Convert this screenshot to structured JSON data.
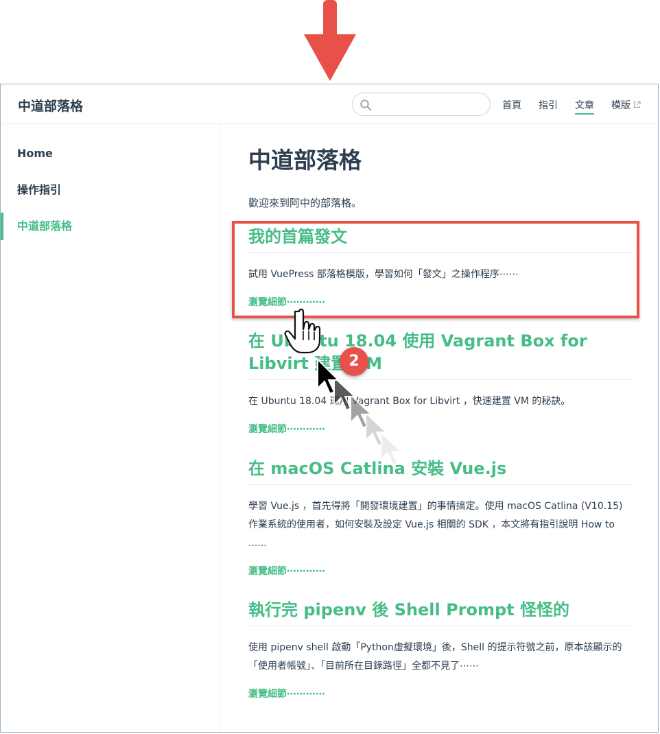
{
  "navbar": {
    "site_name": "中道部落格",
    "search_placeholder": "",
    "links": [
      {
        "label": "首頁"
      },
      {
        "label": "指引"
      },
      {
        "label": "文章"
      },
      {
        "label": "模版"
      }
    ]
  },
  "sidebar": {
    "items": [
      {
        "label": "Home"
      },
      {
        "label": "操作指引"
      },
      {
        "label": "中道部落格"
      }
    ]
  },
  "main": {
    "title": "中道部落格",
    "intro": "歡迎來到阿中的部落格。",
    "posts": [
      {
        "title": "我的首篇發文",
        "excerpt": "試用 VuePress 部落格模版，學習如何「發文」之操作程序⋯⋯",
        "more": "瀏覽細節⋯⋯⋯⋯"
      },
      {
        "title": "在 Ubuntu 18.04 使用 Vagrant Box for Libvirt 建置 VM",
        "excerpt": "在 Ubuntu 18.04 運用 Vagrant Box for Libvirt ，快速建置 VM 的秘訣。",
        "more": "瀏覽細節⋯⋯⋯⋯"
      },
      {
        "title": "在 macOS Catlina 安裝 Vue.js",
        "excerpt": "學習 Vue.js ，首先得將「開發環境建置」的事情搞定。使用 macOS Catlina (V10.15) 作業系統的使用者，如何安裝及設定 Vue.js 相關的 SDK ，本文將有指引說明 How to ......",
        "more": "瀏覽細節⋯⋯⋯⋯"
      },
      {
        "title": "執行完 pipenv 後 Shell Prompt 怪怪的",
        "excerpt": "使用 pipenv shell 啟動「Python虛擬環境」後，Shell 的提示符號之前，原本該顯示的「使用者帳號」、「目前所在目錄路徑」全都不見了⋯⋯",
        "more": "瀏覽細節⋯⋯⋯⋯"
      }
    ]
  },
  "annotation": {
    "step_number": "2"
  },
  "colors": {
    "accent": "#46bd87",
    "text": "#2c3e50",
    "annotation_red": "#e8514a"
  }
}
